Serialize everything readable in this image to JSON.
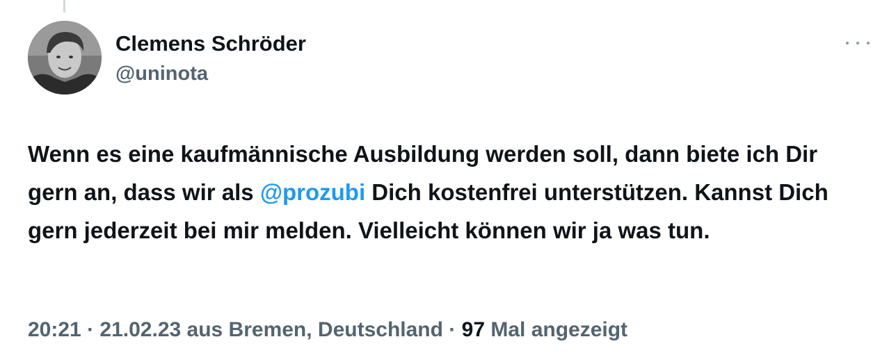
{
  "author": {
    "display_name": "Clemens Schröder",
    "handle": "@uninota",
    "avatar_icon": "user-avatar-photo"
  },
  "menu": {
    "more_icon": "more-horizontal-icon"
  },
  "tweet": {
    "text_part1": "Wenn es eine kaufmännische Ausbildung werden soll, dann biete ich Dir gern an, dass wir als ",
    "mention": "@prozubi",
    "text_part2": " Dich kostenfrei unterstützen. Kannst Dich gern jederzeit bei mir melden. Vielleicht können wir ja was tun."
  },
  "meta": {
    "time": "20:21",
    "separator": " · ",
    "date": "21.02.23",
    "location": " aus Bremen, Deutschland",
    "views_count": "97",
    "views_label": " Mal angezeigt"
  },
  "colors": {
    "text": "#0f1419",
    "secondary": "#536471",
    "link": "#1d9bf0"
  }
}
